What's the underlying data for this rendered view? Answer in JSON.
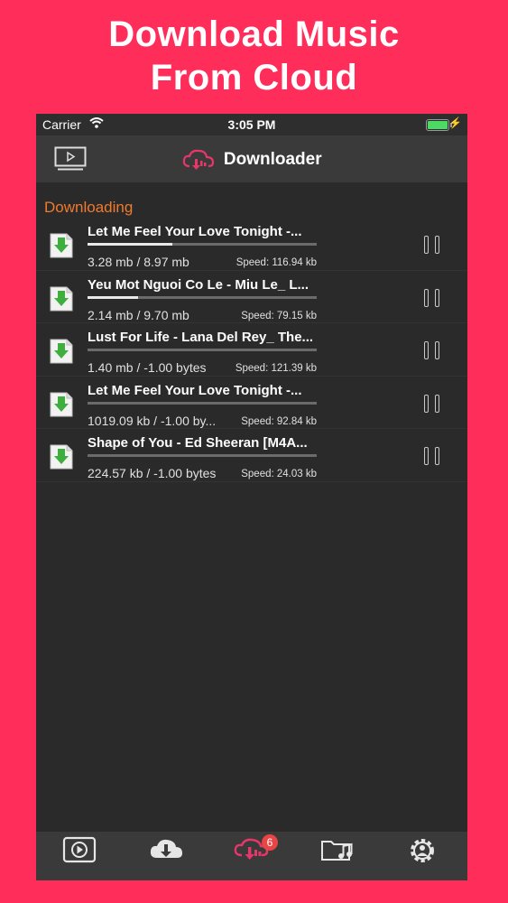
{
  "promo": {
    "line1": "Download Music",
    "line2": "From Cloud"
  },
  "status_bar": {
    "carrier": "Carrier",
    "time": "3:05 PM"
  },
  "navbar": {
    "title": "Downloader",
    "icons": [
      "video-screen-icon",
      "cloud-download-logo-icon"
    ]
  },
  "section": {
    "title": "Downloading"
  },
  "downloads": [
    {
      "name": "Let Me Feel Your Love Tonight -...",
      "size": "3.28 mb / 8.97 mb",
      "speed": "Speed: 116.94 kb",
      "progress": 0.37
    },
    {
      "name": "Yeu Mot Nguoi Co Le - Miu Le_ L...",
      "size": "2.14 mb / 9.70 mb",
      "speed": "Speed: 79.15 kb",
      "progress": 0.22
    },
    {
      "name": "Lust For Life - Lana Del Rey_ The...",
      "size": "1.40 mb / -1.00 bytes",
      "speed": "Speed: 121.39 kb",
      "progress": 0
    },
    {
      "name": "Let Me Feel Your Love Tonight -...",
      "size": "1019.09 kb / -1.00 by...",
      "speed": "Speed: 92.84 kb",
      "progress": 0
    },
    {
      "name": "Shape of You - Ed Sheeran [M4A...",
      "size": "224.57 kb / -1.00 bytes",
      "speed": "Speed: 24.03 kb",
      "progress": 0
    }
  ],
  "tabbar": {
    "badge_count": "6",
    "tabs": [
      "play-icon",
      "cloud-download-icon",
      "cloud-downloading-icon",
      "music-folder-icon",
      "settings-gear-icon"
    ]
  },
  "colors": {
    "background": "#FF2D5A",
    "app_bg": "#2A2A2A",
    "accent_orange": "#F07A2D",
    "brand_pink": "#E8366A",
    "badge_red": "#E84545",
    "download_green": "#3FAE3F"
  }
}
